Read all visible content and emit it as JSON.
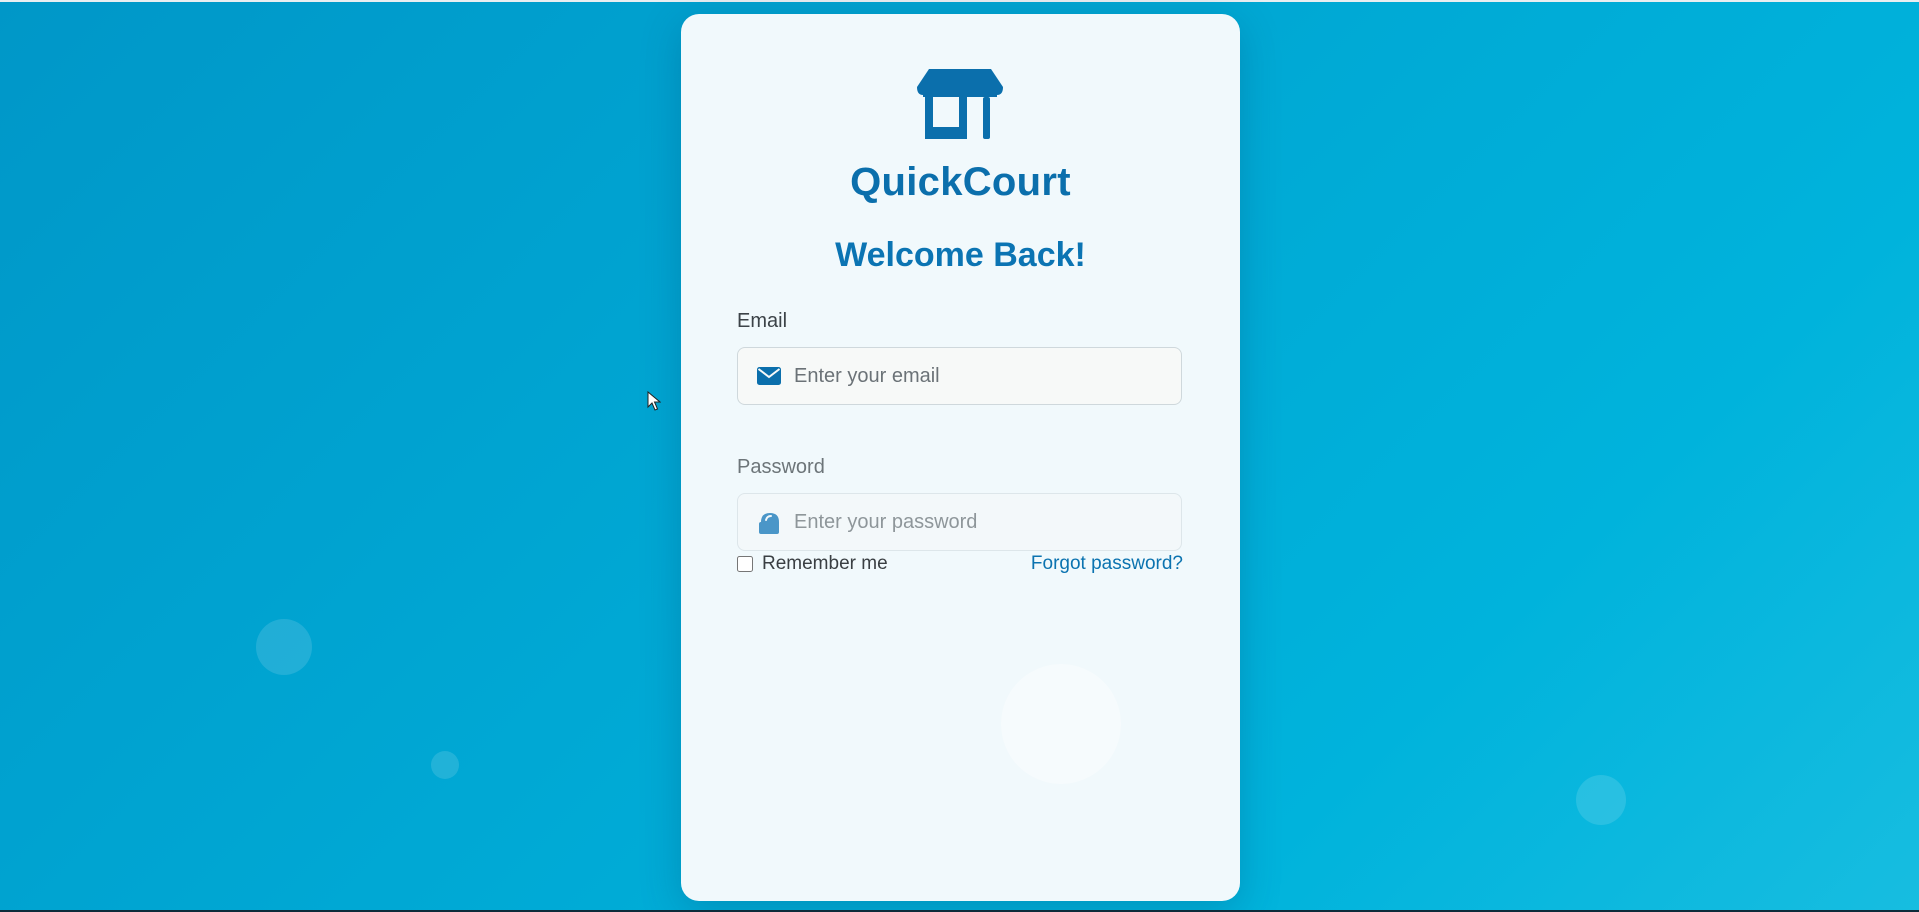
{
  "app": {
    "brand_name": "QuickCourt",
    "logo_icon": "store-icon"
  },
  "login": {
    "heading": "Welcome Back!",
    "email_label": "Email",
    "email_value": "",
    "email_placeholder": "Enter your email",
    "email_icon": "envelope-icon",
    "password_label": "Password",
    "password_value": "",
    "password_placeholder": "Enter your password",
    "password_icon": "lock-icon",
    "remember_label": "Remember me",
    "remember_checked": false,
    "forgot_link": "Forgot password?"
  },
  "colors": {
    "primary": "#0b6fac",
    "background_start": "#0097c8",
    "background_end": "#17bde0",
    "card_background": "#f1f9fc"
  }
}
